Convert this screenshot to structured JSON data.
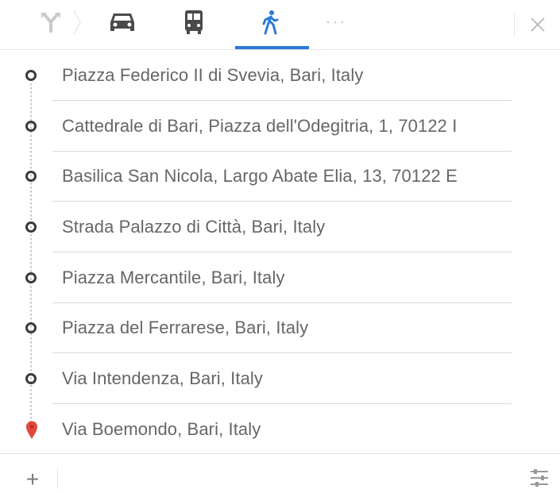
{
  "modes": [
    {
      "name": "best-route",
      "icon": "fork-arrow-icon",
      "selected": false
    },
    {
      "name": "driving",
      "icon": "car-icon",
      "selected": false
    },
    {
      "name": "transit",
      "icon": "bus-icon",
      "selected": false
    },
    {
      "name": "walking",
      "icon": "walking-icon",
      "selected": true
    },
    {
      "name": "more",
      "icon": "more-icon",
      "selected": false
    }
  ],
  "colors": {
    "accent": "#2a79d9",
    "destination_pin": "#e5473b",
    "waypoint_ring": "#3a3a3a"
  },
  "stops": [
    {
      "label": "Piazza Federico II di Svevia, Bari, Italy",
      "icon": "waypoint-circle-icon"
    },
    {
      "label": "Cattedrale di Bari, Piazza dell'Odegitria, 1, 70122 I",
      "icon": "waypoint-circle-icon"
    },
    {
      "label": "Basilica San Nicola, Largo Abate Elia, 13, 70122 E",
      "icon": "waypoint-circle-icon"
    },
    {
      "label": "Strada Palazzo di Città, Bari, Italy",
      "icon": "waypoint-circle-icon"
    },
    {
      "label": "Piazza Mercantile, Bari, Italy",
      "icon": "waypoint-circle-icon"
    },
    {
      "label": "Piazza del Ferrarese, Bari, Italy",
      "icon": "waypoint-circle-icon"
    },
    {
      "label": "Via Intendenza, Bari, Italy",
      "icon": "waypoint-circle-icon"
    },
    {
      "label": "Via Boemondo, Bari, Italy",
      "icon": "destination-pin-icon"
    }
  ],
  "footer": {
    "add_label": "+",
    "options_icon": "route-options-icon"
  }
}
